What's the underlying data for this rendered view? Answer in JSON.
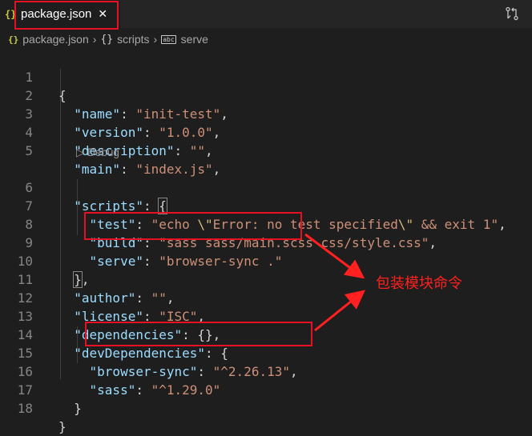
{
  "tab": {
    "icon": "json-icon",
    "title": "package.json",
    "close": "✕"
  },
  "toolbar": {
    "compare_icon": "open-changes-icon"
  },
  "breadcrumb": {
    "file_icon": "{}",
    "file": "package.json",
    "obj_icon": "{}",
    "scripts": "scripts",
    "str_icon": "abc",
    "serve": "serve"
  },
  "codelens": "▷ Debug",
  "lines": {
    "l1": "{",
    "l2_key": "\"name\"",
    "l2_val": "\"init-test\"",
    "l3_key": "\"version\"",
    "l3_val": "\"1.0.0\"",
    "l4_key": "\"description\"",
    "l4_val": "\"\"",
    "l5_key": "\"main\"",
    "l5_val": "\"index.js\"",
    "l6_key": "\"scripts\"",
    "l6_brace": "{",
    "l7_key": "\"test\"",
    "l7_val_a": "\"echo ",
    "l7_esc1": "\\\"",
    "l7_val_b": "Error: no test specified",
    "l7_esc2": "\\\"",
    "l7_val_c": " && exit 1\"",
    "l8_key": "\"build\"",
    "l8_val": "\"sass sass/main.scss css/style.css\"",
    "l9_key": "\"serve\"",
    "l9_val": "\"browser-sync .\"",
    "l10_brace": "}",
    "l11_key": "\"author\"",
    "l11_val": "\"\"",
    "l12_key": "\"license\"",
    "l12_val": "\"ISC\"",
    "l13_key": "\"dependencies\"",
    "l13_val": "{}",
    "l14_key": "\"devDependencies\"",
    "l14_val": "{",
    "l15_key": "\"browser-sync\"",
    "l15_val": "\"^2.26.13\"",
    "l16_key": "\"sass\"",
    "l16_val": "\"^1.29.0\"",
    "l17": "}",
    "l18": "}"
  },
  "line_numbers": [
    "1",
    "2",
    "3",
    "4",
    "5",
    "6",
    "7",
    "8",
    "9",
    "10",
    "11",
    "12",
    "13",
    "14",
    "15",
    "16",
    "17",
    "18"
  ],
  "annotation": "包装模块命令",
  "colors": {
    "highlight": "#e81123",
    "key": "#9cdcfe",
    "string": "#ce9178",
    "escape": "#d7ba7d",
    "background": "#1e1e1e"
  }
}
